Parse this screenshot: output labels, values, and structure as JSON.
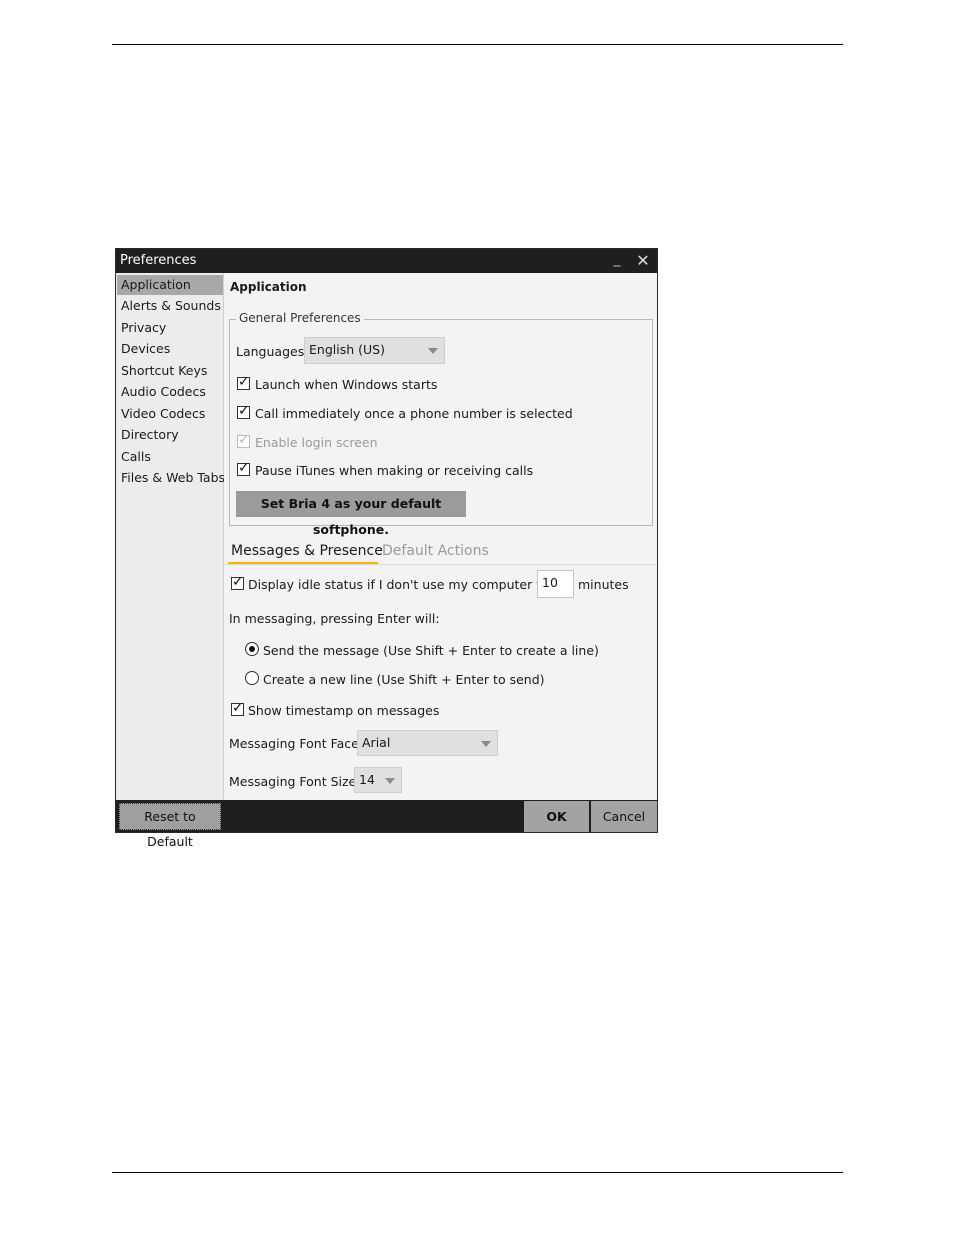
{
  "window": {
    "title": "Preferences",
    "minimize_icon": "minimize-icon",
    "close_icon": "close-icon"
  },
  "sidebar": {
    "items": [
      {
        "label": "Application",
        "selected": true
      },
      {
        "label": "Alerts & Sounds",
        "selected": false
      },
      {
        "label": "Privacy",
        "selected": false
      },
      {
        "label": "Devices",
        "selected": false
      },
      {
        "label": "Shortcut Keys",
        "selected": false
      },
      {
        "label": "Audio Codecs",
        "selected": false
      },
      {
        "label": "Video Codecs",
        "selected": false
      },
      {
        "label": "Directory",
        "selected": false
      },
      {
        "label": "Calls",
        "selected": false
      },
      {
        "label": "Files & Web Tabs",
        "selected": false
      }
    ]
  },
  "main": {
    "heading": "Application",
    "general": {
      "legend": "General Preferences",
      "languages_label": "Languages:",
      "languages_value": "English (US)",
      "launch_label": "Launch when Windows starts",
      "launch_checked": true,
      "call_label": "Call immediately once a phone number is selected",
      "call_checked": true,
      "login_label": "Enable login screen",
      "login_checked": true,
      "login_disabled": true,
      "itunes_label": "Pause iTunes when making or receiving calls",
      "itunes_checked": true,
      "default_button": "Set Bria 4 as your default softphone."
    },
    "tabs": [
      {
        "label": "Messages & Presence",
        "active": true
      },
      {
        "label": "Default Actions",
        "active": false
      }
    ],
    "messages": {
      "idle_label": "Display idle status if I don't use my computer for:",
      "idle_checked": true,
      "idle_value": "10",
      "idle_unit": "minutes",
      "enter_label": "In messaging, pressing Enter will:",
      "radio_send": "Send the message (Use Shift + Enter to create a line)",
      "radio_send_selected": true,
      "radio_newline": "Create a new line (Use Shift + Enter to send)",
      "radio_newline_selected": false,
      "timestamp_label": "Show timestamp on messages",
      "timestamp_checked": true,
      "font_face_label": "Messaging Font Face:",
      "font_face_value": "Arial",
      "font_size_label": "Messaging Font Size:",
      "font_size_value": "14"
    }
  },
  "footer": {
    "reset": "Reset to Default",
    "ok": "OK",
    "cancel": "Cancel"
  },
  "colors": {
    "titlebar": "#1f1f1f",
    "selected_item": "#a8a8a8",
    "tab_accent": "#f2b705"
  }
}
